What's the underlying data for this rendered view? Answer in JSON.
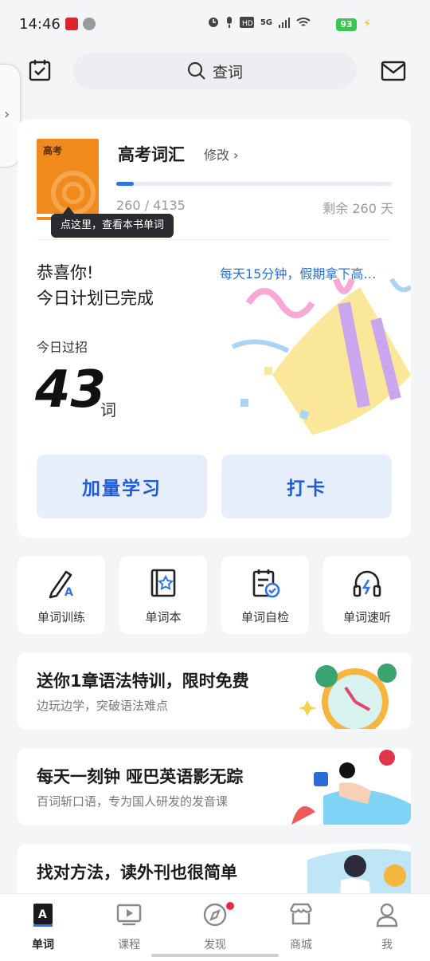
{
  "status_bar": {
    "time": "14:46",
    "network": "5G",
    "battery": "93",
    "colors": {
      "battery": "#35c74e"
    }
  },
  "top_bar": {
    "search_placeholder": "查词"
  },
  "book": {
    "cover_title": "高考",
    "title": "高考词汇",
    "edit_label": "修改 ›",
    "progress_text": "260 / 4135",
    "progress_fraction": 0.063,
    "remaining_text": "剩余 260 天",
    "tooltip": "点这里，查看本书单词"
  },
  "plan": {
    "congrats_line1": "恭喜你!",
    "congrats_line2": "今日计划已完成",
    "motto": "每天15分钟，假期拿下高…",
    "today_label": "今日过招",
    "today_count": "43",
    "today_unit": "词"
  },
  "buttons": {
    "study_more": "加量学习",
    "check_in": "打卡"
  },
  "quick_entries": [
    {
      "label": "单词训练",
      "icon": "pencil-icon"
    },
    {
      "label": "单词本",
      "icon": "notebook-star-icon"
    },
    {
      "label": "单词自检",
      "icon": "clipboard-check-icon"
    },
    {
      "label": "单词速听",
      "icon": "headphones-icon"
    }
  ],
  "promos": [
    {
      "title": "送你1章语法特训，限时免费",
      "subtitle": "边玩边学，突破语法难点"
    },
    {
      "title": "每天一刻钟 哑巴英语影无踪",
      "subtitle": "百词斩口语，专为国人研发的发音课"
    },
    {
      "title": "找对方法，读外刊也很简单",
      "subtitle": ""
    }
  ],
  "tabs": [
    {
      "label": "单词",
      "active": true
    },
    {
      "label": "课程",
      "active": false
    },
    {
      "label": "发现",
      "active": false
    },
    {
      "label": "商城",
      "active": false
    },
    {
      "label": "我",
      "active": false
    }
  ],
  "colors": {
    "accent": "#2f74e8",
    "button_bg": "#e6eefc",
    "button_text": "#1f5bd6",
    "badge": "#f0283c"
  }
}
